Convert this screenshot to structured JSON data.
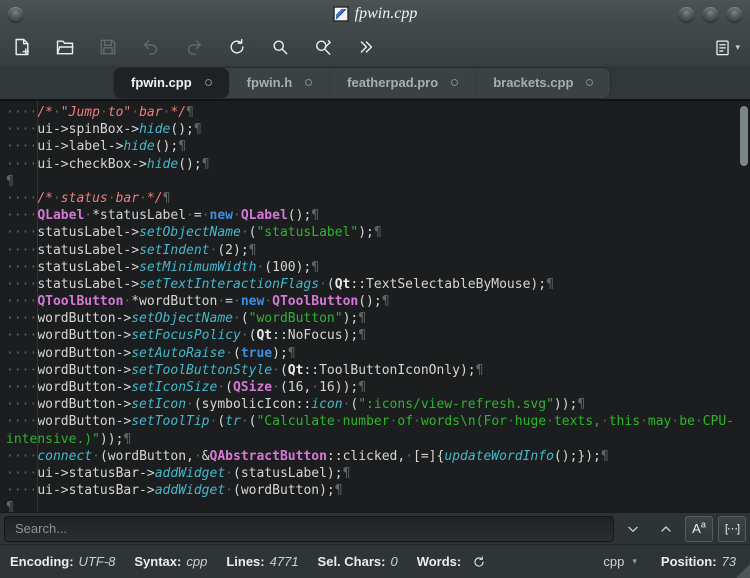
{
  "window": {
    "title": "fpwin.cpp"
  },
  "colors": {
    "syntax": {
      "plain": "#d6d6d6",
      "comment": "#ee7e7e",
      "string": "#2eb52e",
      "type": "#d678d6",
      "keyword": "#3d8fe2",
      "function": "#45b8cc",
      "qt_namespace": "#eaeaea",
      "whitespace_mark": "#5f6465"
    },
    "chrome_top": "#434b4d",
    "tabbar_bg": "#31383a",
    "active_tab_bg": "#1e2224",
    "editor_bg": "#1b1d1e",
    "statusbar_bg": "#2f3436"
  },
  "toolbar": {
    "buttons": [
      {
        "name": "new-document-button",
        "icon": "new-file-icon",
        "enabled": true
      },
      {
        "name": "open-file-button",
        "icon": "open-folder-icon",
        "enabled": true
      },
      {
        "name": "save-button",
        "icon": "save-icon",
        "enabled": false
      },
      {
        "name": "undo-button",
        "icon": "undo-icon",
        "enabled": false
      },
      {
        "name": "redo-button",
        "icon": "redo-icon",
        "enabled": false
      },
      {
        "name": "reload-button",
        "icon": "reload-icon",
        "enabled": true
      },
      {
        "name": "search-button",
        "icon": "search-icon",
        "enabled": true
      },
      {
        "name": "find-replace-button",
        "icon": "find-replace-icon",
        "enabled": true
      },
      {
        "name": "more-actions-button",
        "icon": "double-chevron-icon",
        "enabled": true
      }
    ],
    "menu_button_caret": "▾"
  },
  "tabs": [
    {
      "label": "fpwin.cpp",
      "active": true
    },
    {
      "label": "fpwin.h",
      "active": false
    },
    {
      "label": "featherpad.pro",
      "active": false
    },
    {
      "label": "brackets.cpp",
      "active": false
    }
  ],
  "editor": {
    "lines": [
      {
        "eol": true,
        "segs": [
          [
            "cmt",
            "    /* \"Jump to\" bar */"
          ]
        ]
      },
      {
        "eol": true,
        "segs": [
          [
            "pln",
            "    ui->spinBox->"
          ],
          [
            "fn",
            "hide"
          ],
          [
            "pln",
            "();"
          ]
        ]
      },
      {
        "eol": true,
        "segs": [
          [
            "pln",
            "    ui->label->"
          ],
          [
            "fn",
            "hide"
          ],
          [
            "pln",
            "();"
          ]
        ]
      },
      {
        "eol": true,
        "segs": [
          [
            "pln",
            "    ui->checkBox->"
          ],
          [
            "fn",
            "hide"
          ],
          [
            "pln",
            "();"
          ]
        ]
      },
      {
        "eol": true,
        "segs": []
      },
      {
        "eol": true,
        "segs": [
          [
            "cmt",
            "    /* status bar */"
          ]
        ]
      },
      {
        "eol": true,
        "segs": [
          [
            "pln",
            "    "
          ],
          [
            "typ",
            "QLabel"
          ],
          [
            "pln",
            " *statusLabel = "
          ],
          [
            "kw",
            "new"
          ],
          [
            "pln",
            " "
          ],
          [
            "typ",
            "QLabel"
          ],
          [
            "pln",
            "();"
          ]
        ]
      },
      {
        "eol": true,
        "segs": [
          [
            "pln",
            "    statusLabel->"
          ],
          [
            "fn",
            "setObjectName"
          ],
          [
            "pln",
            " ("
          ],
          [
            "str",
            "\"statusLabel\""
          ],
          [
            "pln",
            ");"
          ]
        ]
      },
      {
        "eol": true,
        "segs": [
          [
            "pln",
            "    statusLabel->"
          ],
          [
            "fn",
            "setIndent"
          ],
          [
            "pln",
            " (2);"
          ]
        ]
      },
      {
        "eol": true,
        "segs": [
          [
            "pln",
            "    statusLabel->"
          ],
          [
            "fn",
            "setMinimumWidth"
          ],
          [
            "pln",
            " (100);"
          ]
        ]
      },
      {
        "eol": true,
        "segs": [
          [
            "pln",
            "    statusLabel->"
          ],
          [
            "fn",
            "setTextInteractionFlags"
          ],
          [
            "pln",
            " ("
          ],
          [
            "qt",
            "Qt"
          ],
          [
            "pln",
            "::TextSelectableByMouse);"
          ]
        ]
      },
      {
        "eol": true,
        "segs": [
          [
            "pln",
            "    "
          ],
          [
            "typ",
            "QToolButton"
          ],
          [
            "pln",
            " *wordButton = "
          ],
          [
            "kw",
            "new"
          ],
          [
            "pln",
            " "
          ],
          [
            "typ",
            "QToolButton"
          ],
          [
            "pln",
            "();"
          ]
        ]
      },
      {
        "eol": true,
        "segs": [
          [
            "pln",
            "    wordButton->"
          ],
          [
            "fn",
            "setObjectName"
          ],
          [
            "pln",
            " ("
          ],
          [
            "str",
            "\"wordButton\""
          ],
          [
            "pln",
            ");"
          ]
        ]
      },
      {
        "eol": true,
        "segs": [
          [
            "pln",
            "    wordButton->"
          ],
          [
            "fn",
            "setFocusPolicy"
          ],
          [
            "pln",
            " ("
          ],
          [
            "qt",
            "Qt"
          ],
          [
            "pln",
            "::NoFocus);"
          ]
        ]
      },
      {
        "eol": true,
        "segs": [
          [
            "pln",
            "    wordButton->"
          ],
          [
            "fn",
            "setAutoRaise"
          ],
          [
            "pln",
            " ("
          ],
          [
            "kw",
            "true"
          ],
          [
            "pln",
            ");"
          ]
        ]
      },
      {
        "eol": true,
        "segs": [
          [
            "pln",
            "    wordButton->"
          ],
          [
            "fn",
            "setToolButtonStyle"
          ],
          [
            "pln",
            " ("
          ],
          [
            "qt",
            "Qt"
          ],
          [
            "pln",
            "::ToolButtonIconOnly);"
          ]
        ]
      },
      {
        "eol": true,
        "segs": [
          [
            "pln",
            "    wordButton->"
          ],
          [
            "fn",
            "setIconSize"
          ],
          [
            "pln",
            " ("
          ],
          [
            "typ",
            "QSize"
          ],
          [
            "pln",
            " (16, 16));"
          ]
        ]
      },
      {
        "eol": true,
        "segs": [
          [
            "pln",
            "    wordButton->"
          ],
          [
            "fn",
            "setIcon"
          ],
          [
            "pln",
            " (symbolicIcon::"
          ],
          [
            "fn",
            "icon"
          ],
          [
            "pln",
            " ("
          ],
          [
            "str",
            "\":icons/view-refresh.svg\""
          ],
          [
            "pln",
            "));"
          ]
        ]
      },
      {
        "eol": false,
        "segs": [
          [
            "pln",
            "    wordButton->"
          ],
          [
            "fn",
            "setToolTip"
          ],
          [
            "pln",
            " ("
          ],
          [
            "fn",
            "tr"
          ],
          [
            "pln",
            " ("
          ],
          [
            "str",
            "\"Calculate number of words\\n(For huge texts, this may be CPU-"
          ]
        ]
      },
      {
        "eol": true,
        "segs": [
          [
            "str",
            "intensive.)\""
          ],
          [
            "pln",
            "));"
          ]
        ]
      },
      {
        "eol": true,
        "segs": [
          [
            "fn",
            "    connect"
          ],
          [
            "pln",
            " (wordButton, &"
          ],
          [
            "typ",
            "QAbstractButton"
          ],
          [
            "pln",
            "::clicked, [=]{"
          ],
          [
            "fn",
            "updateWordInfo"
          ],
          [
            "pln",
            "();});"
          ]
        ]
      },
      {
        "eol": true,
        "segs": [
          [
            "pln",
            "    ui->statusBar->"
          ],
          [
            "fn",
            "addWidget"
          ],
          [
            "pln",
            " (statusLabel);"
          ]
        ]
      },
      {
        "eol": true,
        "segs": [
          [
            "pln",
            "    ui->statusBar->"
          ],
          [
            "fn",
            "addWidget"
          ],
          [
            "pln",
            " (wordButton);"
          ]
        ]
      },
      {
        "eol": true,
        "segs": []
      }
    ],
    "pilcrow": "¶",
    "space_mark": "·"
  },
  "search": {
    "placeholder": "Search...",
    "match_case_letter": "A",
    "match_case_sup": "a",
    "whole_word_icon_text": "[⋯]"
  },
  "statusbar": {
    "encoding_label": "Encoding:",
    "encoding_value": "UTF-8",
    "syntax_label": "Syntax:",
    "syntax_value": "cpp",
    "lines_label": "Lines:",
    "lines_value": "4771",
    "sel_chars_label": "Sel. Chars:",
    "sel_chars_value": "0",
    "words_label": "Words:",
    "lang_selector_value": "cpp",
    "lang_selector_caret": "▾",
    "position_label": "Position:",
    "position_value": "73"
  }
}
